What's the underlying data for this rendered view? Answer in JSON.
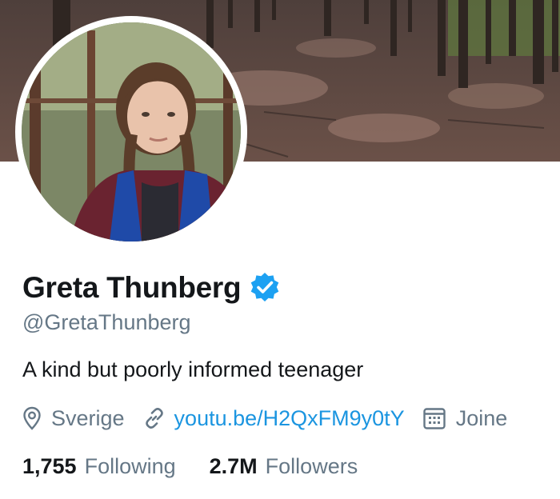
{
  "profile": {
    "name": "Greta Thunberg",
    "handle": "@GretaThunberg",
    "bio": "A kind but poorly informed teenager",
    "location": "Sverige",
    "website": "youtu.be/H2QxFM9y0tY",
    "joined": "Joine"
  },
  "stats": {
    "following_count": "1,755",
    "following_label": "Following",
    "followers_count": "2.7M",
    "followers_label": "Followers"
  },
  "colors": {
    "accent": "#1da1f2",
    "link": "#1b95e0",
    "secondary_text": "#657786",
    "primary_text": "#14171a"
  },
  "icons": {
    "verified": "verified-badge-icon",
    "location": "location-pin-icon",
    "link": "link-icon",
    "calendar": "calendar-icon"
  }
}
